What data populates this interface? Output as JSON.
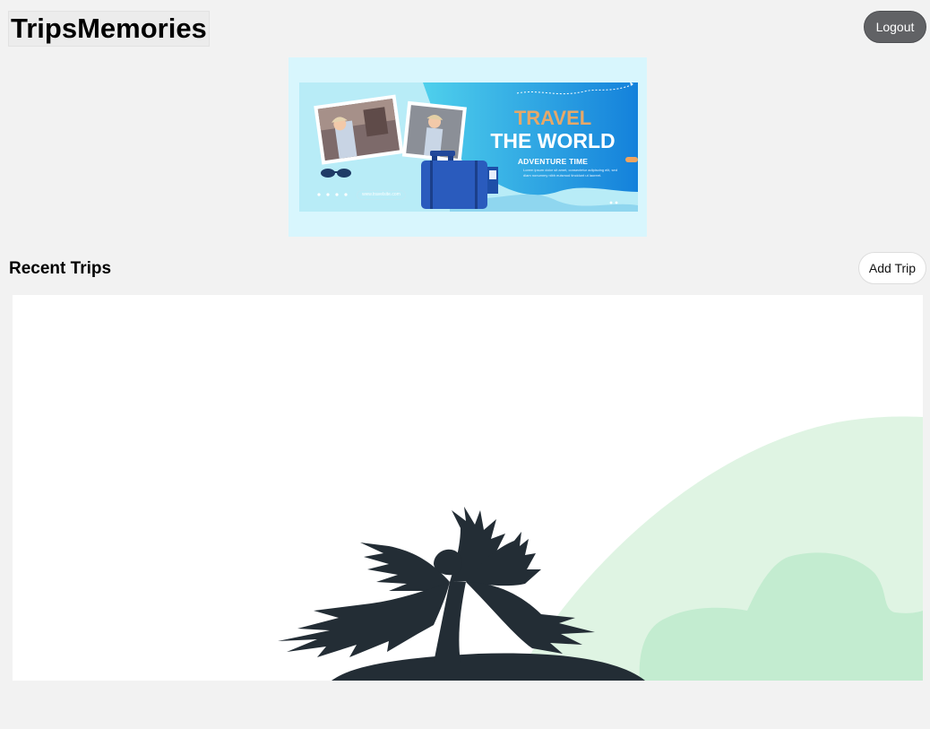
{
  "header": {
    "title": "TripsMemories",
    "logout_label": "Logout"
  },
  "banner": {
    "headline_line1": "TRAVEL",
    "headline_line2": "THE WORLD",
    "subheadline": "ADVENTURE TIME",
    "body_text": "Lorem ipsum dolor sit amet, consectetur adipiscing elit, sed diam nonummy nibh euismod tincidunt ut laoreet.",
    "url": "www.travelsite.com"
  },
  "recent_trips": {
    "title": "Recent Trips",
    "add_trip_label": "Add Trip"
  },
  "colors": {
    "page_background": "#f2f2f2",
    "logout_button": "#616265",
    "banner_background": "#d8f6fd",
    "banner_blue": "#1a8fe0",
    "headline_orange": "#e7a868",
    "hill_light": "#dff4e3",
    "bush_green": "#c3ecd0",
    "palm_silhouette": "#232d35"
  }
}
